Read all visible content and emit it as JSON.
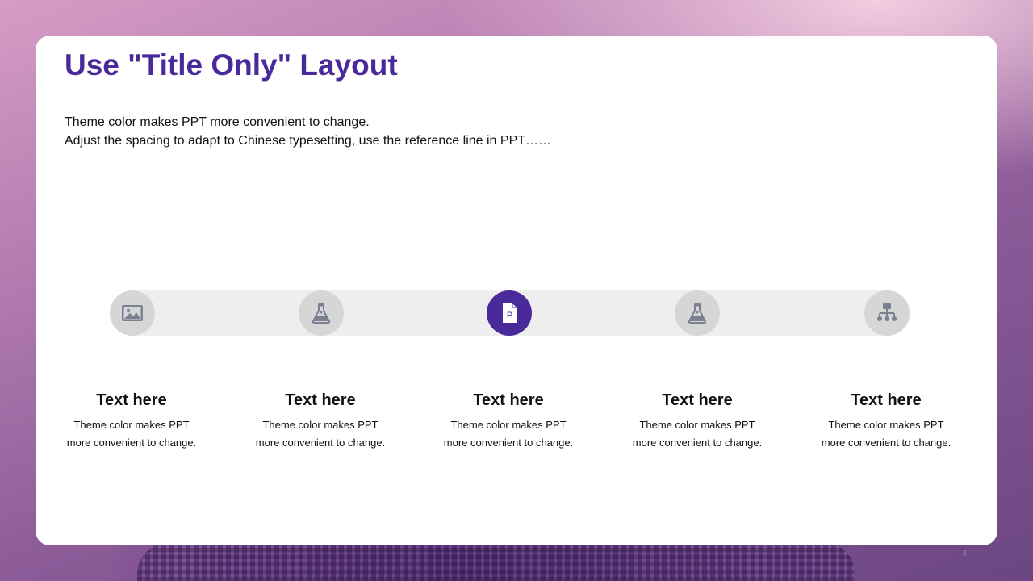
{
  "slide": {
    "title": "Use \"Title Only\" Layout",
    "description": [
      "Theme color makes PPT more convenient to change.",
      "Adjust the spacing to adapt to Chinese typesetting, use the reference line in PPT……"
    ],
    "page_number": "4"
  },
  "timeline": {
    "active_index": 2,
    "colors": {
      "accent": "#4a2a9a",
      "node": "#d6d6d6",
      "track": "#eeeeee",
      "icon": "#7a8090"
    },
    "steps": [
      {
        "icon": "image-icon",
        "heading": "Text here",
        "body": [
          "Theme color makes PPT",
          "more convenient  to change."
        ]
      },
      {
        "icon": "flask-icon",
        "heading": "Text here",
        "body": [
          "Theme color makes PPT",
          "more convenient  to change."
        ]
      },
      {
        "icon": "document-p-icon",
        "icon_letter": "P",
        "heading": "Text here",
        "body": [
          "Theme color makes PPT",
          "more convenient  to change."
        ]
      },
      {
        "icon": "flask-icon",
        "heading": "Text here",
        "body": [
          "Theme color makes PPT",
          "more convenient  to change."
        ]
      },
      {
        "icon": "org-chart-icon",
        "heading": "Text here",
        "body": [
          "Theme color makes PPT",
          "more convenient  to change."
        ]
      }
    ]
  }
}
